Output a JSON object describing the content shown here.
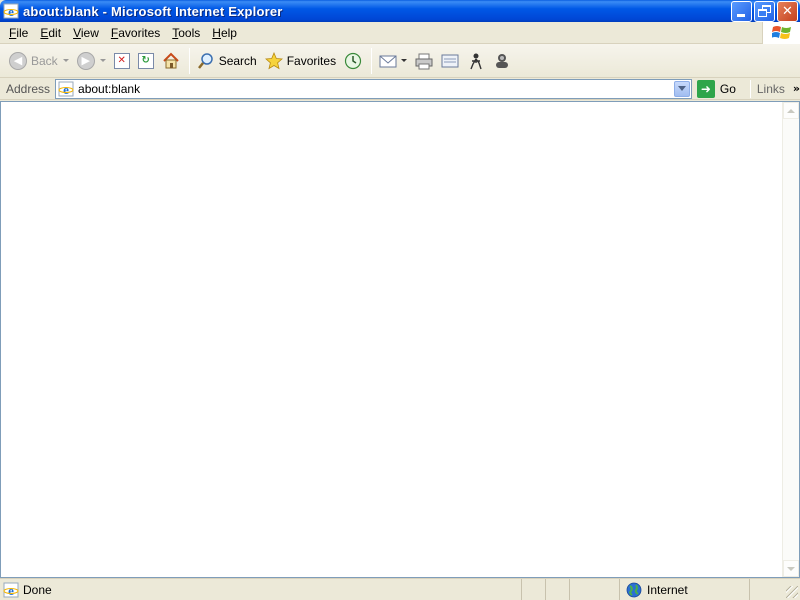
{
  "window": {
    "title": "about:blank - Microsoft Internet Explorer"
  },
  "menu": {
    "items": [
      {
        "mnemonic": "F",
        "rest": "ile"
      },
      {
        "mnemonic": "E",
        "rest": "dit"
      },
      {
        "mnemonic": "V",
        "rest": "iew"
      },
      {
        "mnemonic": "F",
        "rest": "avorites",
        "pre": ""
      },
      {
        "mnemonic": "T",
        "rest": "ools"
      },
      {
        "mnemonic": "H",
        "rest": "elp"
      }
    ]
  },
  "toolbar": {
    "back_label": "Back",
    "search_label": "Search",
    "favorites_label": "Favorites"
  },
  "address": {
    "label": "Address",
    "value": "about:blank",
    "go_label": "Go",
    "links_label": "Links"
  },
  "status": {
    "text": "Done",
    "zone": "Internet"
  },
  "colors": {
    "titlebar": "#0058e6",
    "chrome": "#ece9d8",
    "content": "#ffffff",
    "go": "#2ea54a"
  }
}
